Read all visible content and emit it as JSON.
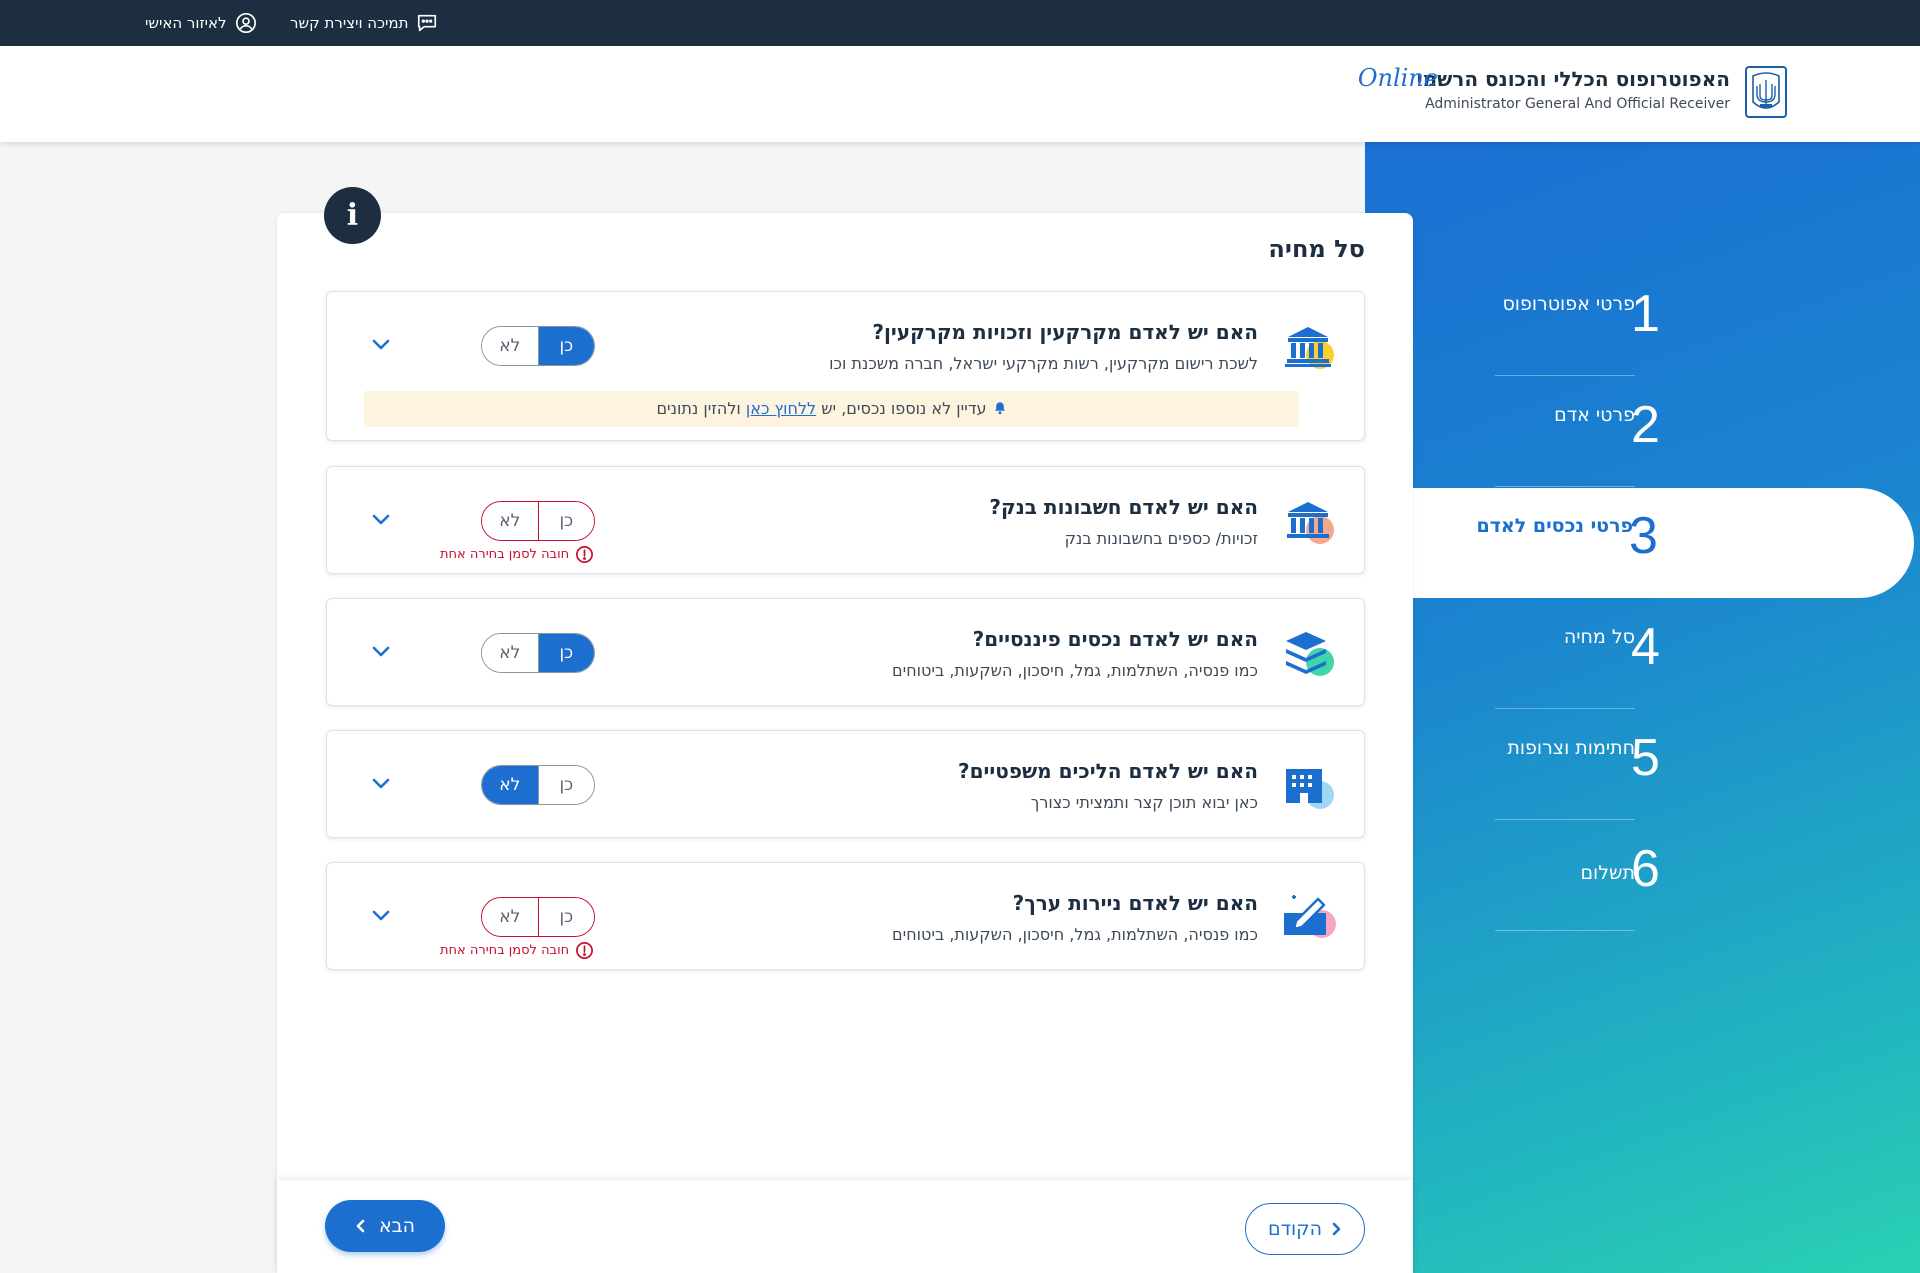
{
  "topbar": {
    "personal_area": "לאיזור האישי",
    "support": "תמיכה ויצירת קשר"
  },
  "header": {
    "brand_he": "האפוטרופוס הכללי והכונס הרשמי",
    "brand_online": "Online",
    "brand_en": "Administrator General And Official Receiver"
  },
  "colors": {
    "accent": "#1d6fcf",
    "topbar": "#1c2e40",
    "error": "#c8102e",
    "notice_bg": "#fdf4df"
  },
  "steps": [
    {
      "num": "1",
      "label": "פרטי אפוטרופוס",
      "active": false
    },
    {
      "num": "2",
      "label": "פרטי אדם",
      "active": false
    },
    {
      "num": "3",
      "label": "פרטי נכסים לאדם",
      "active": true
    },
    {
      "num": "4",
      "label": "סל מחיה",
      "active": false
    },
    {
      "num": "5",
      "label": "חתימות וצרופות",
      "active": false
    },
    {
      "num": "6",
      "label": "תשלום",
      "active": false
    }
  ],
  "card": {
    "info_icon": "i",
    "title": "סל מחיה",
    "yes_label": "כן",
    "no_label": "לא",
    "error_text": "חובה לסמן בחירה אחת",
    "questions": [
      {
        "icon": "bank-building-icon",
        "title": "האם יש לאדם מקרקעין וזכויות מקרקעין?",
        "subtitle": "לשכת רישום מקרקעין, רשות מקרקעי ישראל, חברה משכנת וכו",
        "answer": "yes",
        "error": false,
        "notice": {
          "before": "עדיין לא נוספו נכסים, יש",
          "link": "ללחוץ כאן",
          "after": "ולהזין נתונים"
        }
      },
      {
        "icon": "bank-icon",
        "title": "האם יש לאדם חשבונות בנק?",
        "subtitle": "זכויות/ כספים בחשבונות בנק",
        "answer": null,
        "error": true
      },
      {
        "icon": "layers-icon",
        "title": "האם יש לאדם נכסים פיננסיים?",
        "subtitle": "כמו פנסיה, השתלמות, גמל, חיסכון, השקעות, ביטוחים",
        "answer": "yes",
        "error": false
      },
      {
        "icon": "court-building-icon",
        "title": "האם יש לאדם הליכים משפטיים?",
        "subtitle": "כאן יבוא תוכן קצר ותמציתי כצורך",
        "answer": "no",
        "error": false
      },
      {
        "icon": "securities-icon",
        "title": "האם יש לאדם ניירות ערך?",
        "subtitle": "כמו פנסיה, השתלמות, גמל, חיסכון, השקעות, ביטוחים",
        "answer": null,
        "error": true
      }
    ]
  },
  "footer": {
    "next": "הבא",
    "prev": "הקודם"
  }
}
